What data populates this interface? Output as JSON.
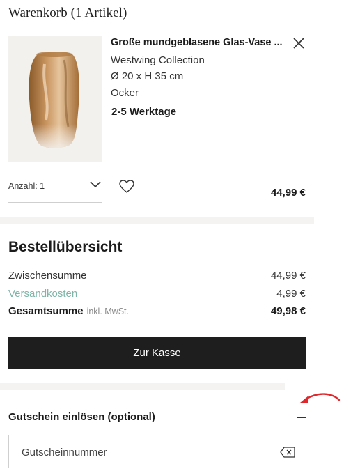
{
  "cart": {
    "title": "Warenkorb (1 Artikel)"
  },
  "product": {
    "name": "Große mundgeblasene Glas-Vase ...",
    "brand": "Westwing Collection",
    "dimensions": "Ø 20 x H 35 cm",
    "color": "Ocker",
    "delivery": "2-5 Werktage",
    "quantity_label": "Anzahl: 1",
    "price": "44,99 €"
  },
  "summary": {
    "title": "Bestellübersicht",
    "subtotal_label": "Zwischensumme",
    "subtotal_value": "44,99 €",
    "shipping_label": "Versandkosten",
    "shipping_value": "4,99 €",
    "total_label": "Gesamtsumme",
    "total_note": "inkl. MwSt.",
    "total_value": "49,98 €",
    "checkout_label": "Zur Kasse"
  },
  "voucher": {
    "title": "Gutschein einlösen (optional)",
    "placeholder": "Gutscheinnummer"
  },
  "icons": {
    "remove": "close-icon",
    "quantity": "chevron-down-icon",
    "wishlist": "heart-icon",
    "collapse": "minus-icon",
    "clear": "backspace-icon",
    "annotation": "arrow-icon"
  },
  "colors": {
    "accent_link": "#7fb5a7",
    "button_bg": "#1e1e1e",
    "divider": "#f4f3f1",
    "annotation": "#e0282c"
  }
}
